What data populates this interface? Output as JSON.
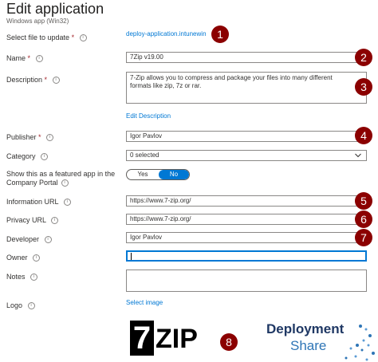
{
  "header": {
    "title": "Edit application",
    "subtitle": "Windows app (Win32)"
  },
  "fields": {
    "select_file": {
      "label": "Select file to update",
      "value": "deploy-application.intunewin"
    },
    "name": {
      "label": "Name",
      "value": "7Zip v19.00"
    },
    "description": {
      "label": "Description",
      "value": "7-Zip allows you to compress and package your files into many different formats like zip, 7z or rar.",
      "edit_link": "Edit Description"
    },
    "publisher": {
      "label": "Publisher",
      "value": "Igor Pavlov"
    },
    "category": {
      "label": "Category",
      "value": "0 selected"
    },
    "featured": {
      "label_line1": "Show this as a featured app in the",
      "label_line2": "Company Portal",
      "yes": "Yes",
      "no": "No",
      "selected": "No"
    },
    "info_url": {
      "label": "Information URL",
      "value": "https://www.7-zip.org/"
    },
    "privacy_url": {
      "label": "Privacy URL",
      "value": "https://www.7-zip.org/"
    },
    "developer": {
      "label": "Developer",
      "value": "Igor Pavlov"
    },
    "owner": {
      "label": "Owner",
      "value": ""
    },
    "notes": {
      "label": "Notes",
      "value": ""
    },
    "logo": {
      "label": "Logo",
      "link": "Select image"
    }
  },
  "required_mark": "*",
  "info_glyph": "i",
  "badges": [
    "1",
    "2",
    "3",
    "4",
    "5",
    "6",
    "7",
    "8"
  ],
  "logos": {
    "sevenzip_digit": "7",
    "sevenzip_text": "ZIP",
    "deployment_line1": "Deployment",
    "deployment_line2": "Share"
  },
  "colors": {
    "accent": "#0078d4",
    "badge": "#8b0000",
    "required": "#a4262c"
  }
}
